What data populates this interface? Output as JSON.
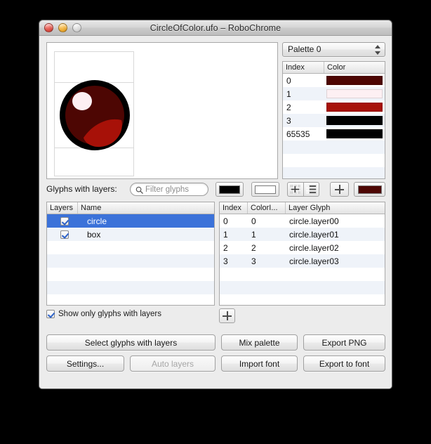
{
  "window": {
    "title": "CircleOfColor.ufo – RoboChrome",
    "traffic_lights": [
      "close-button",
      "minimize-button",
      "zoom-button"
    ]
  },
  "palette_selector": {
    "selected": "Palette 0"
  },
  "palette_table": {
    "columns": [
      "Index",
      "Color"
    ],
    "rows": [
      {
        "index": "0",
        "color": "#4d0603"
      },
      {
        "index": "1",
        "color": "#fdf0f3"
      },
      {
        "index": "2",
        "color": "#a71108"
      },
      {
        "index": "3",
        "color": "#000000"
      },
      {
        "index": "65535",
        "color": "#000000"
      }
    ]
  },
  "toolbar": {
    "glyphs_label": "Glyphs with layers:",
    "search_placeholder": "Filter glyphs",
    "search_value": "",
    "fill_color": "#000000",
    "stroke_color": "#ffffff",
    "swatch_color": "#4d0603",
    "add_label": "+"
  },
  "layers_table": {
    "columns": [
      "Layers",
      "Name"
    ],
    "rows": [
      {
        "checked": true,
        "name": "circle",
        "selected": true
      },
      {
        "checked": true,
        "name": "box",
        "selected": false
      }
    ]
  },
  "layerindex_table": {
    "columns": [
      "Index",
      "ColorI...",
      "Layer Glyph"
    ],
    "rows": [
      {
        "index": "0",
        "color_index": "0",
        "layer_glyph": "circle.layer00"
      },
      {
        "index": "1",
        "color_index": "1",
        "layer_glyph": "circle.layer01"
      },
      {
        "index": "2",
        "color_index": "2",
        "layer_glyph": "circle.layer02"
      },
      {
        "index": "3",
        "color_index": "3",
        "layer_glyph": "circle.layer03"
      }
    ],
    "add_label": "+"
  },
  "options": {
    "show_only_label": "Show only glyphs with layers",
    "show_only_checked": true
  },
  "buttons": {
    "select_glyphs": "Select glyphs with layers",
    "mix_palette": "Mix palette",
    "export_png": "Export PNG",
    "settings": "Settings...",
    "auto_layers": "Auto layers",
    "import_font": "Import font",
    "export_font": "Export to font"
  },
  "glyph_preview": {
    "outline_color": "#000000",
    "body_color": "#4d0603",
    "highlight_color": "#fdf0f3",
    "accent_color": "#a71108"
  }
}
